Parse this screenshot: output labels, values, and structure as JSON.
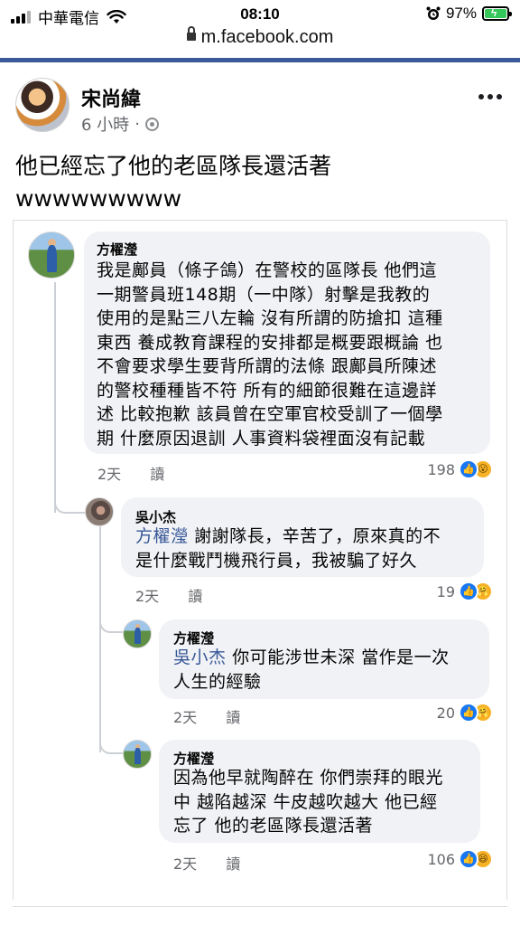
{
  "status": {
    "carrier": "中華電信",
    "time": "08:10",
    "battery": "97%"
  },
  "url": "m.facebook.com",
  "post": {
    "author": "宋尚緯",
    "time": "6 小時",
    "separator": "·",
    "text_line1": "他已經忘了他的老區隊長還活著",
    "text_line2": "wwwwwwwww"
  },
  "comments": [
    {
      "name": "方櫂瀅",
      "lines": [
        "我是鄺員（條子鴿）在警校的區隊長 他們這",
        "一期警員班148期（一中隊）射擊是我教的",
        "使用的是點三八左輪 沒有所謂的防搶扣 這種",
        "東西 養成教育課程的安排都是概要跟概論 也",
        "不會要求學生要背所謂的法條 跟鄺員所陳述",
        "的警校種種皆不符 所有的細節很難在這邊詳",
        "述 比較抱歉 該員曾在空軍官校受訓了一個學",
        "期 什麼原因退訓 人事資料袋裡面沒有記載"
      ],
      "time": "2天",
      "action": "讀",
      "count": "198",
      "reactions": [
        "like-icon",
        "wow-icon"
      ]
    },
    {
      "name": "吳小杰",
      "mention": "方櫂瀅",
      "line1_rest": "謝謝隊長，辛苦了，原來真的不",
      "line2": "是什麼戰鬥機飛行員，我被騙了好久",
      "time": "2天",
      "action": "讀",
      "count": "19",
      "reactions": [
        "like-icon",
        "care-icon"
      ]
    },
    {
      "name": "方櫂瀅",
      "mention": "吳小杰",
      "line1_rest": "你可能涉世未深 當作是一次",
      "line2": "人生的經驗",
      "time": "2天",
      "action": "讀",
      "count": "20",
      "reactions": [
        "like-icon",
        "care-icon"
      ]
    },
    {
      "name": "方櫂瀅",
      "lines": [
        "因為他早就陶醉在 你們崇拜的眼光",
        "中 越陷越深 牛皮越吹越大 他已經",
        "忘了 他的老區隊長還活著"
      ],
      "time": "2天",
      "action": "讀",
      "count": "106",
      "reactions": [
        "like-icon",
        "haha-icon"
      ]
    }
  ]
}
